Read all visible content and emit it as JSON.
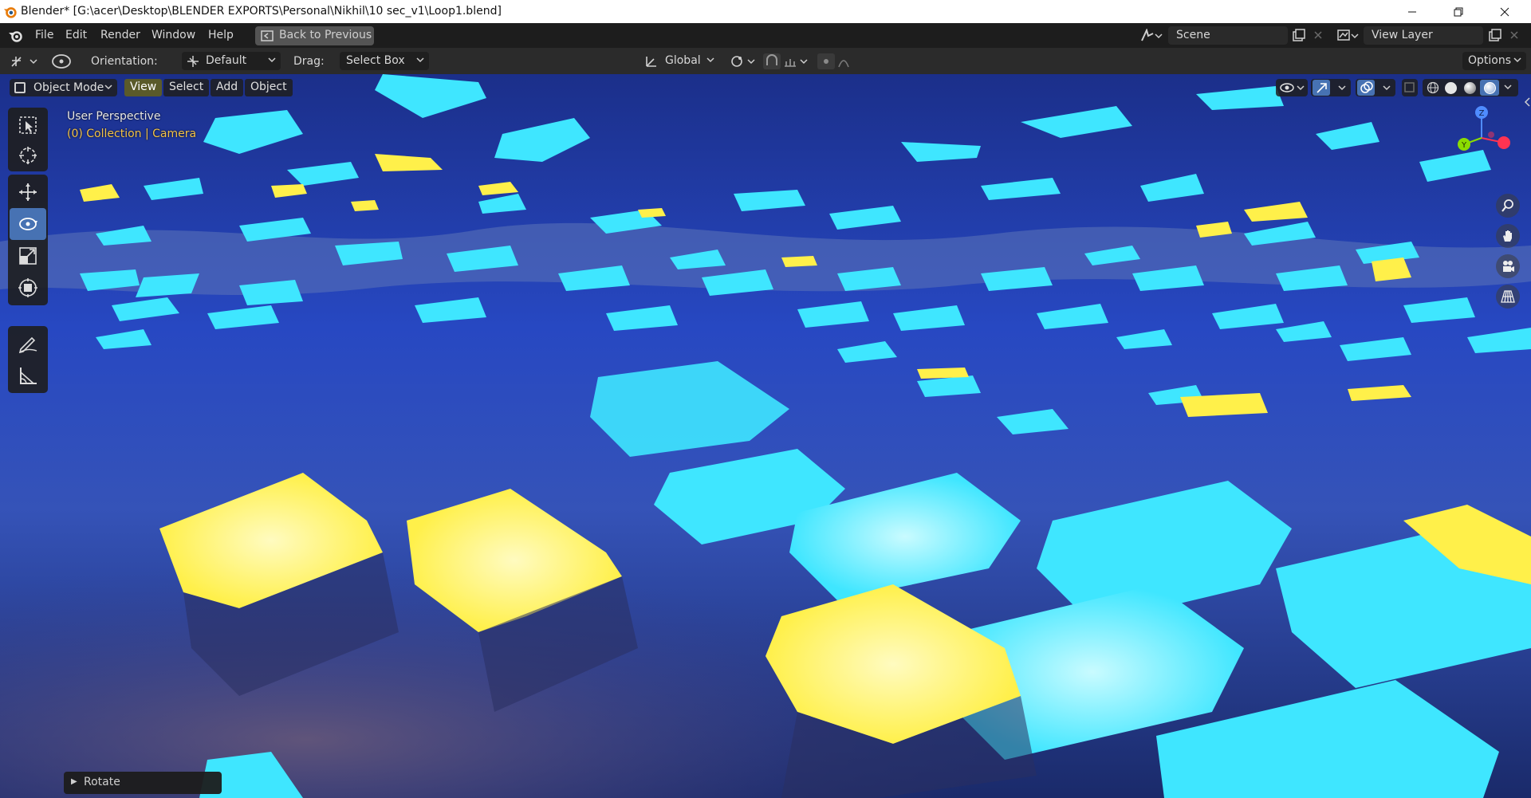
{
  "window": {
    "title": "Blender* [G:\\acer\\Desktop\\BLENDER EXPORTS\\Personal\\Nikhil\\10 sec_v1\\Loop1.blend]"
  },
  "menubar": {
    "items": [
      "File",
      "Edit",
      "Render",
      "Window",
      "Help"
    ],
    "back_button": "Back to Previous",
    "scene": "Scene",
    "view_layer": "View Layer"
  },
  "tool_header": {
    "orientation_label": "Orientation:",
    "orientation_value": "Default",
    "drag_label": "Drag:",
    "drag_value": "Select Box",
    "transform_orientation": "Global",
    "options": "Options"
  },
  "viewport_header": {
    "mode": "Object Mode",
    "menus": [
      "View",
      "Select",
      "Add",
      "Object"
    ],
    "active_menu": "View"
  },
  "viewport": {
    "perspective": "User Perspective",
    "collection_info": "(0) Collection | Camera"
  },
  "gizmo": {
    "axes": [
      "X",
      "Y",
      "Z"
    ]
  },
  "operator_panel": {
    "label": "Rotate"
  },
  "colors": {
    "accent": "#4772b3",
    "cyan_tile": "#3fe6ff",
    "yellow_tile": "#fff04a",
    "bg_dark": "#1d1d1d"
  }
}
